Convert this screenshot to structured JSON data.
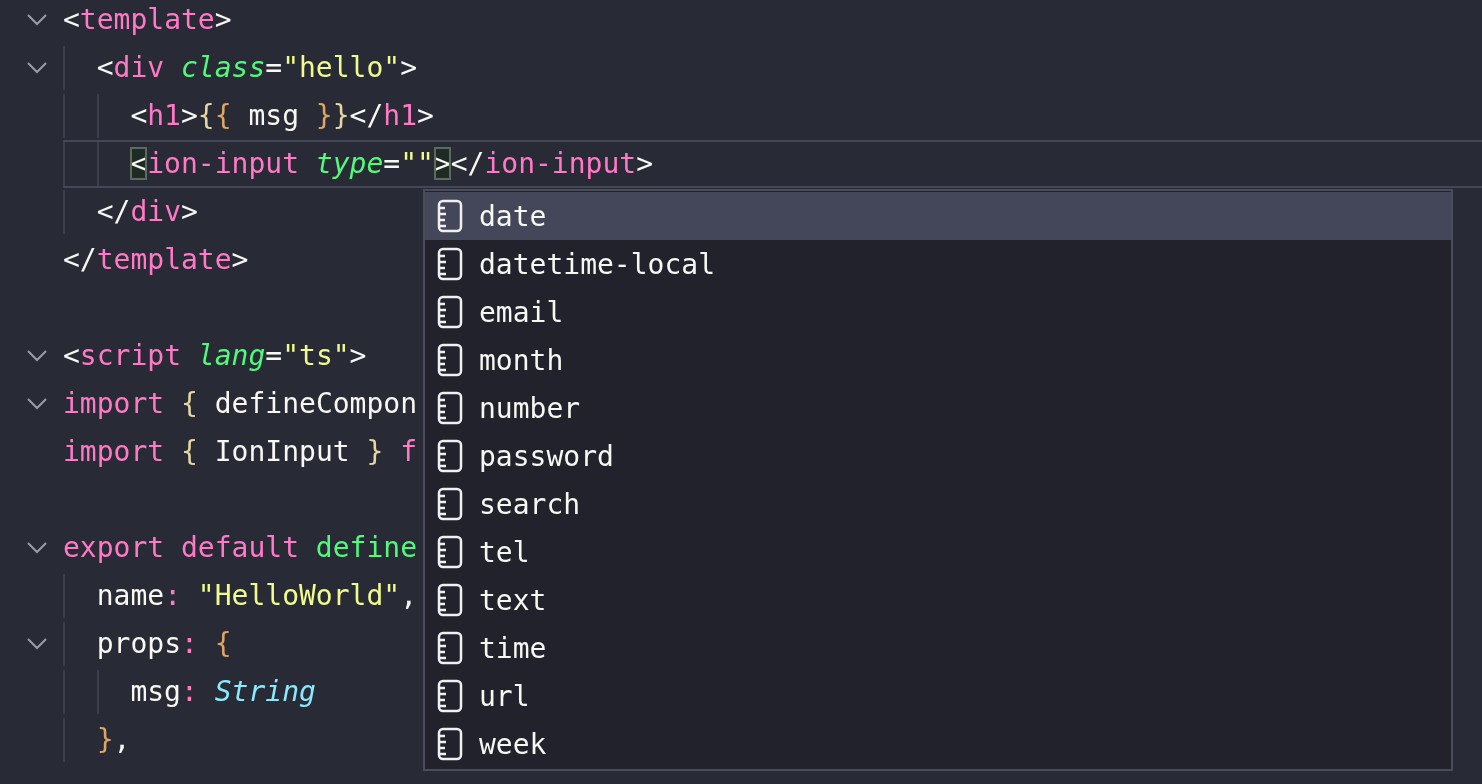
{
  "editor": {
    "lines": [
      {
        "kind": "code",
        "expanded": true,
        "tokens": [
          {
            "kind": "punct",
            "text": "<"
          },
          {
            "kind": "tag",
            "text": "template"
          },
          {
            "kind": "punct",
            "text": ">"
          }
        ],
        "children": [
          {
            "kind": "code",
            "expanded": true,
            "tokens": [
              {
                "kind": "punct",
                "text": "<"
              },
              {
                "kind": "tag",
                "text": "div"
              },
              {
                "kind": "attr",
                "text": " class"
              },
              {
                "kind": "punct",
                "text": "="
              },
              {
                "kind": "string",
                "text": "\"hello\""
              },
              {
                "kind": "punct",
                "text": ">"
              }
            ],
            "children": [
              {
                "kind": "code",
                "tokens": [
                  {
                    "kind": "punct",
                    "text": "<"
                  },
                  {
                    "kind": "tag",
                    "text": "h1"
                  },
                  {
                    "kind": "punct",
                    "text": ">"
                  },
                  {
                    "kind": "brace1",
                    "text": "{"
                  },
                  {
                    "kind": "brace2",
                    "text": "{"
                  },
                  {
                    "kind": "plain",
                    "text": " msg "
                  },
                  {
                    "kind": "brace2",
                    "text": "}"
                  },
                  {
                    "kind": "brace1",
                    "text": "}"
                  },
                  {
                    "kind": "punct",
                    "text": "</"
                  },
                  {
                    "kind": "tag",
                    "text": "h1"
                  },
                  {
                    "kind": "punct",
                    "text": ">"
                  }
                ]
              },
              {
                "kind": "code",
                "current": true,
                "tokens": [
                  {
                    "kind": "match",
                    "text": "<"
                  },
                  {
                    "kind": "tag",
                    "text": "ion-input"
                  },
                  {
                    "kind": "attr",
                    "text": " type"
                  },
                  {
                    "kind": "punct",
                    "text": "="
                  },
                  {
                    "kind": "string",
                    "text": "\"\""
                  },
                  {
                    "kind": "match",
                    "text": ">"
                  },
                  {
                    "kind": "punct",
                    "text": "</"
                  },
                  {
                    "kind": "tag",
                    "text": "ion-input"
                  },
                  {
                    "kind": "punct",
                    "text": ">"
                  }
                ]
              }
            ]
          },
          {
            "kind": "code",
            "tokens": [
              {
                "kind": "punct",
                "text": "</"
              },
              {
                "kind": "tag",
                "text": "div"
              },
              {
                "kind": "punct",
                "text": ">"
              }
            ]
          }
        ]
      },
      {
        "kind": "code",
        "tokens": [
          {
            "kind": "punct",
            "text": "</"
          },
          {
            "kind": "tag",
            "text": "template"
          },
          {
            "kind": "punct",
            "text": ">"
          }
        ]
      },
      {
        "kind": "blank"
      },
      {
        "kind": "code",
        "expanded": true,
        "tokens": [
          {
            "kind": "punct",
            "text": "<"
          },
          {
            "kind": "tag",
            "text": "script"
          },
          {
            "kind": "attr",
            "text": " lang"
          },
          {
            "kind": "punct",
            "text": "="
          },
          {
            "kind": "string",
            "text": "\"ts\""
          },
          {
            "kind": "punct",
            "text": ">"
          }
        ]
      },
      {
        "kind": "code",
        "expanded": true,
        "tokens": [
          {
            "kind": "keyword",
            "text": "import"
          },
          {
            "kind": "brace1",
            "text": " {"
          },
          {
            "kind": "plain",
            "text": " defineCompon"
          }
        ]
      },
      {
        "kind": "code",
        "tokens": [
          {
            "kind": "keyword",
            "text": "import"
          },
          {
            "kind": "brace1",
            "text": " {"
          },
          {
            "kind": "plain",
            "text": " IonInput "
          },
          {
            "kind": "brace1",
            "text": "}"
          },
          {
            "kind": "keyword",
            "text": " f"
          }
        ]
      },
      {
        "kind": "blank"
      },
      {
        "kind": "code",
        "expanded": true,
        "tokens": [
          {
            "kind": "keyword",
            "text": "export default"
          },
          {
            "kind": "func",
            "text": " define"
          }
        ],
        "children": [
          {
            "kind": "code",
            "tokens": [
              {
                "kind": "plain",
                "text": "name"
              },
              {
                "kind": "colon",
                "text": ":"
              },
              {
                "kind": "string",
                "text": " \"HelloWorld\""
              },
              {
                "kind": "plain",
                "text": ","
              }
            ]
          },
          {
            "kind": "code",
            "expanded": true,
            "tokens": [
              {
                "kind": "plain",
                "text": "props"
              },
              {
                "kind": "colon",
                "text": ":"
              },
              {
                "kind": "brace2",
                "text": " {"
              }
            ],
            "children": [
              {
                "kind": "code",
                "tokens": [
                  {
                    "kind": "plain",
                    "text": "msg"
                  },
                  {
                    "kind": "colon",
                    "text": ":"
                  },
                  {
                    "kind": "type",
                    "text": " String"
                  }
                ]
              }
            ]
          },
          {
            "kind": "code",
            "tokens": [
              {
                "kind": "brace2",
                "text": "}"
              },
              {
                "kind": "plain",
                "text": ","
              }
            ]
          }
        ]
      }
    ]
  },
  "suggestions": [
    {
      "label": "date",
      "selected": true
    },
    {
      "label": "datetime-local",
      "selected": false
    },
    {
      "label": "email",
      "selected": false
    },
    {
      "label": "month",
      "selected": false
    },
    {
      "label": "number",
      "selected": false
    },
    {
      "label": "password",
      "selected": false
    },
    {
      "label": "search",
      "selected": false
    },
    {
      "label": "tel",
      "selected": false
    },
    {
      "label": "text",
      "selected": false
    },
    {
      "label": "time",
      "selected": false
    },
    {
      "label": "url",
      "selected": false
    },
    {
      "label": "week",
      "selected": false
    }
  ]
}
